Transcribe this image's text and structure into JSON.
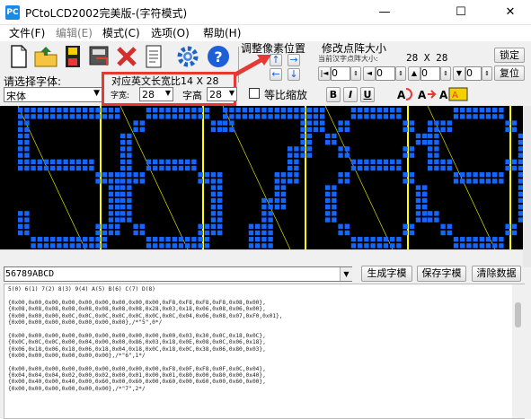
{
  "window": {
    "title": "PCtoLCD2002完美版-(字符模式)",
    "icon_text": "PC",
    "minimize_glyph": "—",
    "maximize_glyph": "☐",
    "close_glyph": "✕"
  },
  "menu": [
    {
      "label": "文件(F)"
    },
    {
      "label": "编辑(E)"
    },
    {
      "label": "模式(C)"
    },
    {
      "label": "选项(O)"
    },
    {
      "label": "帮助(H)"
    }
  ],
  "toolbar": {
    "icons": [
      "new-file-icon",
      "open-folder-icon",
      "save-icon",
      "save-as-image-icon",
      "delete-icon",
      "document-icon",
      "settings-gear-icon",
      "help-icon"
    ]
  },
  "adjust_panel": {
    "title": "调整像素位置",
    "arrows": [
      "←",
      "↑",
      "→",
      "↓",
      "◄",
      "►"
    ]
  },
  "matrix_panel": {
    "title": "修改点阵大小",
    "subtitle": "当前汉字点阵大小:",
    "current_size": "28 X 28",
    "spin_values": [
      "0",
      "0",
      "0",
      "0",
      "0",
      "0"
    ],
    "lock_label": "锁定",
    "reset_label": "复位"
  },
  "font_row": {
    "select_font_label": "请选择字体:",
    "font_name": "宋体",
    "width_label": "字宽:",
    "width_value": "28",
    "height_label": "字高",
    "height_value": "28",
    "scale_label": "等比缩放",
    "bold_label": "B",
    "italic_label": "I",
    "underline_label": "U"
  },
  "annotation": {
    "text": "对应英文长宽比14 X 28",
    "color": "#e53935"
  },
  "display": {
    "chars": "56789",
    "pixel_color": "#1565ff",
    "grid_line_color": "#ffff00"
  },
  "bottom": {
    "input_value": "56789ABCD",
    "generate_label": "生成字模",
    "save_label": "保存字模",
    "clear_label": "清除数据"
  },
  "output_lines": [
    "5(0) 6(1) 7(2) 8(3) 9(4) A(5) B(6) C(7) D(8)",
    "",
    "{0x00,0x00,0x00,0x00,0x00,0x00,0x00,0x00,0x00,0xF8,0xF8,0xF8,0xF8,0x08,0x00},",
    "{0x08,0x08,0x08,0x08,0x08,0x08,0x08,0x08,0x28,0x03,0x18,0x06,0x08,0x06,0x00},",
    "{0x00,0x00,0x00,0x0C,0x0C,0x0C,0x0C,0x0C,0x0C,0x0C,0x04,0x06,0x08,0x07,0xF0,0x01},",
    "{0x00,0x00,0x00,0x00,0x00,0x00,0x00},/*\"5\",0*/",
    "",
    "{0x00,0x00,0x00,0x00,0x00,0x00,0x00,0x00,0x00,0x00,0x03,0x30,0x0C,0x18,0x0C},",
    "{0x0C,0x0C,0x0C,0x00,0x04,0x00,0x00,0x86,0x03,0x18,0x0E,0x08,0x0C,0x06,0x18},",
    "{0x06,0x18,0x06,0x18,0x06,0x18,0x04,0x18,0x0C,0x18,0x0C,0x38,0x06,0x80,0x03},",
    "{0x00,0x00,0x00,0x00,0x00,0x00},/*\"6\",1*/",
    "",
    "{0x00,0x00,0x00,0x00,0x00,0x00,0x00,0x00,0x00,0xF8,0x0F,0xF8,0x0F,0x0C,0x04},",
    "{0x04,0x04,0x04,0x02,0x00,0x02,0x00,0x01,0x00,0x01,0x80,0x00,0x80,0x00,0x40},",
    "{0x00,0x40,0x00,0x40,0x00,0x60,0x00,0x60,0x00,0x60,0x00,0x60,0x00,0x60,0x00},",
    "{0x00,0x00,0x00,0x00,0x00,0x00},/*\"7\",2*/"
  ]
}
